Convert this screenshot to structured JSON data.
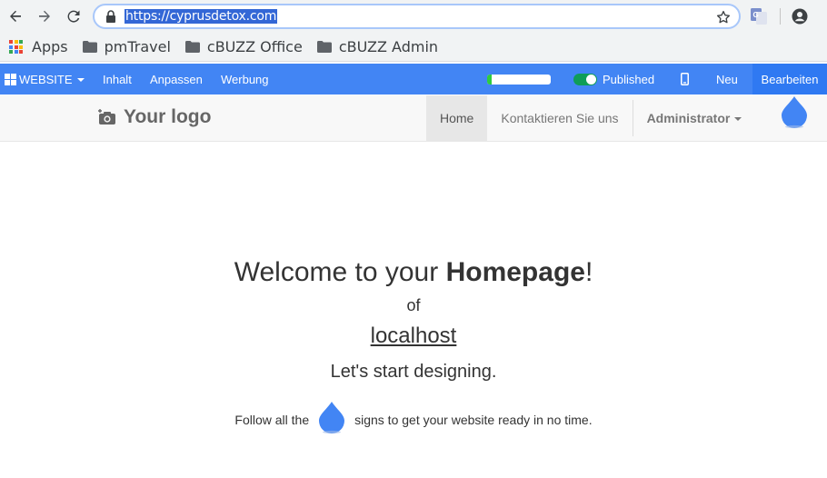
{
  "browser": {
    "url": "https://cyprusdetox.com",
    "bookmarks": [
      {
        "label": "Apps",
        "type": "apps"
      },
      {
        "label": "pmTravel",
        "type": "folder"
      },
      {
        "label": "cBUZZ Office",
        "type": "folder"
      },
      {
        "label": "cBUZZ Admin",
        "type": "folder"
      }
    ],
    "icons": {
      "back": "arrow-left-icon",
      "forward": "arrow-right-icon",
      "reload": "reload-icon",
      "lock": "lock-icon",
      "bookmark": "star-icon",
      "translate": "google-translate-icon",
      "profile": "account-circle-icon"
    }
  },
  "cms_toolbar": {
    "website_label": "WEBSITE",
    "inhalt_label": "Inhalt",
    "anpassen_label": "Anpassen",
    "werbung_label": "Werbung",
    "progress_fraction": 0.07,
    "published_label": "Published",
    "neu_label": "Neu",
    "bearbeiten_label": "Bearbeiten",
    "colors": {
      "bar": "#4285f4",
      "progress": "#2ecc40",
      "toggle": "#0f9d58"
    }
  },
  "site_header": {
    "logo_text": "Your logo",
    "nav": [
      {
        "label": "Home",
        "active": true
      },
      {
        "label": "Kontaktieren Sie uns",
        "active": false
      }
    ],
    "admin_label": "Administrator"
  },
  "main": {
    "title_prefix": "Welcome to your ",
    "title_bold": "Homepage",
    "title_suffix": "!",
    "of_text": "of",
    "site_link": "localhost",
    "start_text": "Let's start designing.",
    "hint_prefix": "Follow all the",
    "hint_suffix": "signs to get your website ready in no time."
  },
  "accent_color": "#4285f4"
}
